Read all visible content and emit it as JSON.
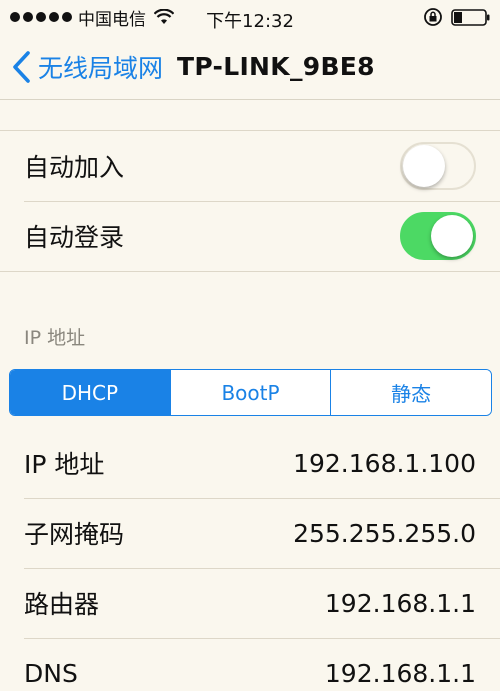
{
  "status_bar": {
    "carrier": "中国电信",
    "time": "下午12:32",
    "signal_bars": 5
  },
  "nav": {
    "back_label": "无线局域网",
    "title": "TP-LINK_9BE8"
  },
  "settings": {
    "auto_join": {
      "label": "自动加入",
      "on": false
    },
    "auto_login": {
      "label": "自动登录",
      "on": true
    }
  },
  "ip_section": {
    "header": "IP 地址",
    "segments": [
      "DHCP",
      "BootP",
      "静态"
    ],
    "selected_segment": "DHCP"
  },
  "ip_rows": [
    {
      "label": "IP 地址",
      "value": "192.168.1.100"
    },
    {
      "label": "子网掩码",
      "value": "255.255.255.0"
    },
    {
      "label": "路由器",
      "value": "192.168.1.1"
    },
    {
      "label": "DNS",
      "value": "192.168.1.1"
    }
  ],
  "colors": {
    "accent": "#1a82e6",
    "toggle_on": "#4cd964",
    "background": "#faf7ee"
  }
}
